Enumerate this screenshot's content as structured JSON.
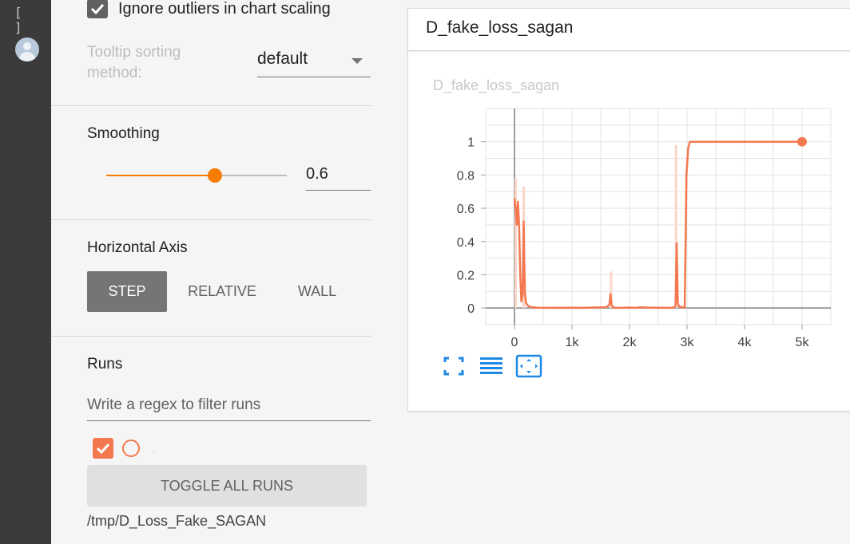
{
  "rail": {
    "brackets": "[ ]",
    "avatar_icon": "account-circle-icon"
  },
  "settings": {
    "ignore_outliers": {
      "checked": true,
      "label": "Ignore outliers in chart scaling"
    },
    "tooltip": {
      "label": "Tooltip sorting method:",
      "value": "default"
    },
    "smoothing": {
      "title": "Smoothing",
      "value": "0.6",
      "fraction": 0.6
    },
    "horizontal_axis": {
      "title": "Horizontal Axis",
      "options": [
        "STEP",
        "RELATIVE",
        "WALL"
      ],
      "selected": "STEP"
    },
    "runs": {
      "title": "Runs",
      "filter_placeholder": "Write a regex to filter runs",
      "run_label": ".",
      "toggle_label": "TOGGLE ALL RUNS",
      "run_path": "/tmp/D_Loss_Fake_SAGAN"
    }
  },
  "card": {
    "header": "D_fake_loss_sagan",
    "tools": [
      "fit-domain-icon",
      "toggle-log-scale-icon",
      "expand-icon"
    ]
  },
  "colors": {
    "accent": "#f57c00",
    "series": "#f4784f",
    "series_raw": "#fbd6c8",
    "active_button": "#757575"
  },
  "chart_data": {
    "type": "line",
    "title": "D_fake_loss_sagan",
    "xlabel": "",
    "ylabel": "",
    "xlim": [
      -500,
      5500
    ],
    "ylim": [
      -0.1,
      1.2
    ],
    "x_ticks": [
      0,
      1000,
      2000,
      3000,
      4000,
      5000
    ],
    "x_tick_labels": [
      "0",
      "1k",
      "2k",
      "3k",
      "4k",
      "5k"
    ],
    "y_ticks": [
      0,
      0.2,
      0.4,
      0.6,
      0.8,
      1
    ],
    "y_tick_labels": [
      "0",
      "0.2",
      "0.4",
      "0.6",
      "0.8",
      "1"
    ],
    "grid": true,
    "series": [
      {
        "x": [
          0,
          20,
          40,
          60,
          80,
          100,
          120,
          140,
          160,
          180,
          200,
          220,
          250,
          300,
          400,
          600,
          800,
          1000,
          1200,
          1400,
          1600,
          1650,
          1670,
          1690,
          1710,
          1750,
          1900,
          2000,
          2100,
          2200,
          2400,
          2600,
          2750,
          2800,
          2820,
          2840,
          2860,
          2900,
          2960,
          2990,
          3020,
          3050,
          3100,
          3200,
          3500,
          4000,
          4500,
          5000
        ],
        "y": [
          0.66,
          0.6,
          0.5,
          0.64,
          0.5,
          0.2,
          0.04,
          0.08,
          0.52,
          0.1,
          0.03,
          0.02,
          0.01,
          0.005,
          0.002,
          0.001,
          0.001,
          0.002,
          0.001,
          0.003,
          0.005,
          0.02,
          0.085,
          0.02,
          0.005,
          0.002,
          0.001,
          0.003,
          0.001,
          0.004,
          0.002,
          0.001,
          0.002,
          0.01,
          0.39,
          0.03,
          0.01,
          0.005,
          0.005,
          0.8,
          0.96,
          1,
          1,
          1,
          1,
          1,
          1,
          1
        ]
      }
    ],
    "raw_spikes": [
      {
        "x": 20,
        "y": 0.78
      },
      {
        "x": 160,
        "y": 0.73
      },
      {
        "x": 1680,
        "y": 0.22
      },
      {
        "x": 2810,
        "y": 0.98
      }
    ],
    "end_marker": {
      "x": 5000,
      "y": 1
    }
  }
}
